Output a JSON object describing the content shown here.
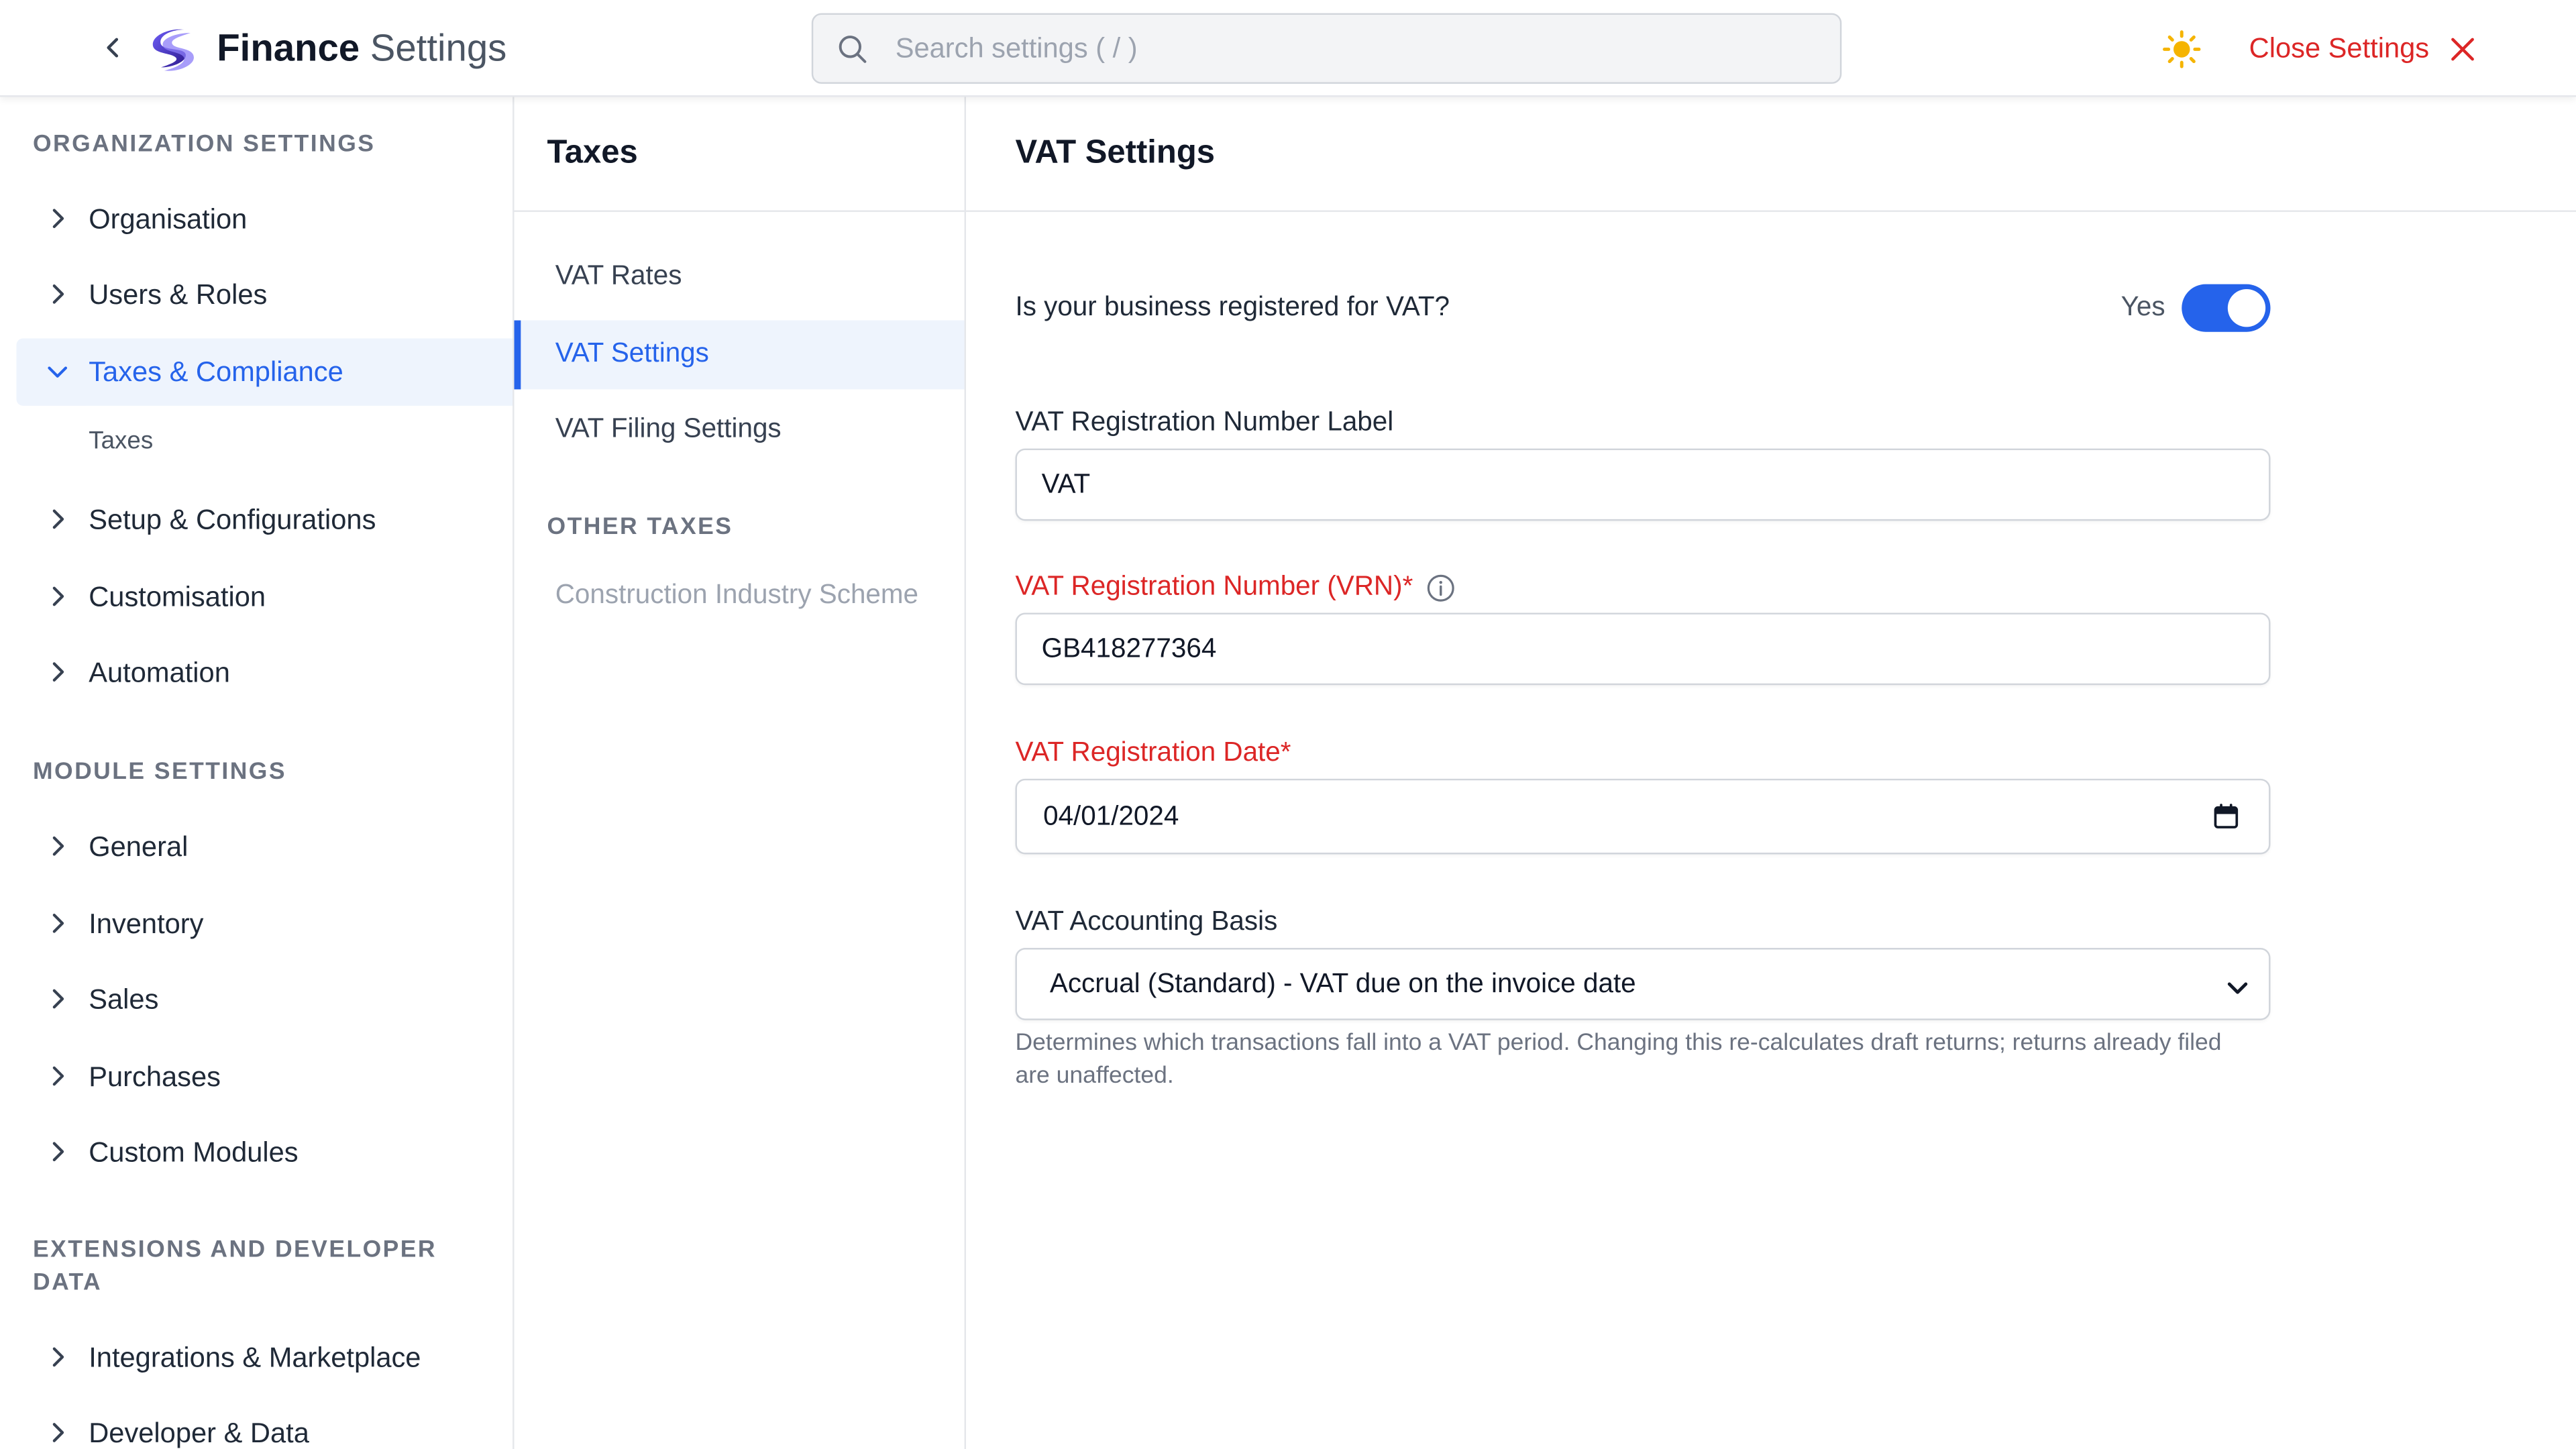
{
  "header": {
    "title_bold": "Finance",
    "title_rest": "Settings",
    "search_placeholder": "Search settings ( / )",
    "close_label": "Close Settings",
    "icons": {
      "back": "chevron-left-icon",
      "logo": "brand-logo",
      "search": "search-icon",
      "theme": "sun-icon",
      "close": "close-icon"
    }
  },
  "sidebar": {
    "sections": [
      {
        "title": "ORGANIZATION SETTINGS"
      },
      {
        "title": "MODULE SETTINGS"
      },
      {
        "title": "EXTENSIONS AND DEVELOPER DATA"
      }
    ],
    "items": [
      {
        "label": "Organisation",
        "expanded": false
      },
      {
        "label": "Users & Roles",
        "expanded": false
      },
      {
        "label": "Taxes & Compliance",
        "expanded": true,
        "active": true
      },
      {
        "label": "Setup & Configurations",
        "expanded": false
      },
      {
        "label": "Customisation",
        "expanded": false
      },
      {
        "label": "Automation",
        "expanded": false
      },
      {
        "label": "General",
        "expanded": false
      },
      {
        "label": "Inventory",
        "expanded": false
      },
      {
        "label": "Sales",
        "expanded": false
      },
      {
        "label": "Purchases",
        "expanded": false
      },
      {
        "label": "Custom Modules",
        "expanded": false
      },
      {
        "label": "Integrations & Marketplace",
        "expanded": false
      },
      {
        "label": "Developer & Data",
        "expanded": false
      }
    ],
    "sub_items": [
      {
        "label": "Taxes"
      }
    ]
  },
  "middle": {
    "title": "Taxes",
    "items": [
      {
        "label": "VAT Rates"
      },
      {
        "label": "VAT Settings",
        "active": true
      },
      {
        "label": "VAT Filing Settings"
      }
    ],
    "other_title": "OTHER TAXES",
    "other_items": [
      {
        "label": "Construction Industry Scheme",
        "disabled": true
      }
    ]
  },
  "main": {
    "title": "VAT Settings",
    "registered_question": "Is your business registered for VAT?",
    "registered_value": "Yes",
    "registered_on": true,
    "vrn_label_label": "VAT Registration Number Label",
    "vrn_label_value": "VAT",
    "vrn_label": "VAT Registration Number (VRN)*",
    "vrn_value": "GB418277364",
    "reg_date_label": "VAT Registration Date*",
    "reg_date_value": "04/01/2024",
    "basis_label": "VAT Accounting Basis",
    "basis_value": "Accrual (Standard) - VAT due on the invoice date",
    "basis_help": "Determines which transactions fall into a VAT period. Changing this re-calculates draft returns; returns already filed are unaffected."
  },
  "colors": {
    "accent": "#2563eb",
    "danger": "#dc2626",
    "active_bg": "#eef4fd",
    "sun": "#f5b400"
  }
}
